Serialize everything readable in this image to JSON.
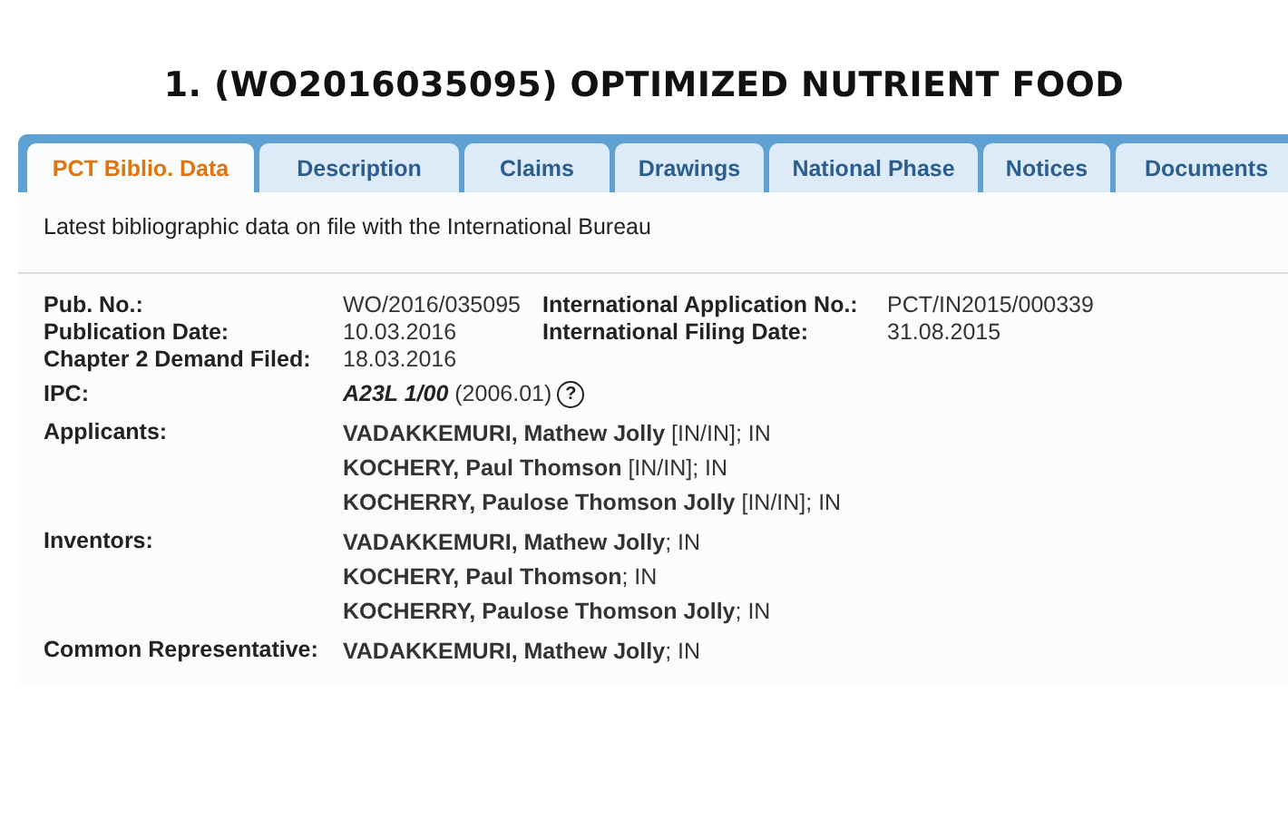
{
  "heading": "1. (WO2016035095) OPTIMIZED NUTRIENT FOOD",
  "tabs": [
    {
      "label": "PCT Biblio. Data",
      "selected": true
    },
    {
      "label": "Description",
      "selected": false
    },
    {
      "label": "Claims",
      "selected": false
    },
    {
      "label": "Drawings",
      "selected": false
    },
    {
      "label": "National Phase",
      "selected": false
    },
    {
      "label": "Notices",
      "selected": false
    },
    {
      "label": "Documents",
      "selected": false
    }
  ],
  "intro": "Latest bibliographic data on file with the International Bureau",
  "summary": [
    {
      "label": "Pub. No.:",
      "value": "WO/2016/035095",
      "label_2": "International Application No.:",
      "value_2": "PCT/IN2015/000339"
    },
    {
      "label": "Publication Date:",
      "value": "10.03.2016",
      "label_2": "International Filing Date:",
      "value_2": "31.08.2015"
    },
    {
      "label": "Chapter 2 Demand Filed:",
      "value": "18.03.2016"
    }
  ],
  "ipc": {
    "label": "IPC:",
    "code": "A23L 1/00",
    "version": "(2006.01)",
    "help": "?"
  },
  "parties": [
    {
      "label": "Applicants:",
      "names": [
        "**VADAKKEMURI, Mathew Jolly** [IN/IN]; IN",
        "**KOCHERY, Paul Thomson** [IN/IN]; IN",
        "**KOCHERRY, Paulose Thomson Jolly** [IN/IN]; IN"
      ]
    },
    {
      "label": "Inventors:",
      "names": [
        "**VADAKKEMURI, Mathew Jolly**; IN",
        "**KOCHERY, Paul Thomson**; IN",
        "**KOCHERRY, Paulose Thomson Jolly**; IN"
      ]
    },
    {
      "label": "Common Representative:",
      "names": [
        "**VADAKKEMURI, Mathew Jolly**; IN"
      ]
    }
  ]
}
